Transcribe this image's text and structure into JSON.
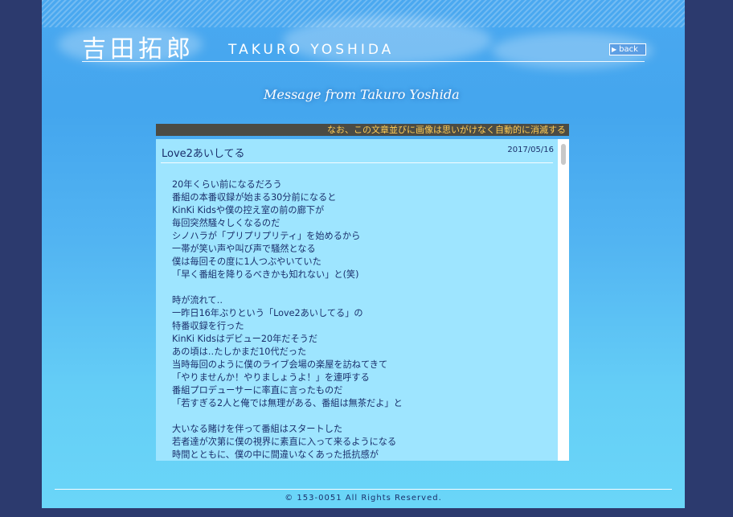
{
  "header": {
    "title_jp": "吉田拓郎",
    "title_en": "TAKURO YOSHIDA",
    "back_label": "back",
    "subtitle": "Message from Takuro Yoshida"
  },
  "notice": "なお、この文章並びに画像は思いがけなく自動的に消滅する",
  "post": {
    "title": "Love2あいしてる",
    "date": "2017/05/16",
    "lines": [
      "20年くらい前になるだろう",
      "番組の本番収録が始まる30分前になると",
      "KinKi Kidsや僕の控え室の前の廊下が",
      "毎回突然騒々しくなるのだ",
      "シノハラが「プリプリプリティ」を始めるから",
      "一帯が笑い声や叫び声で騒然となる",
      "僕は毎回その度に1人つぶやいていた",
      "「早く番組を降りるべきかも知れない」と(笑)",
      "",
      "時が流れて‥",
      "一昨日16年ぶりという「Love2あいしてる」の",
      "特番収録を行った",
      "KinKi Kidsはデビュー20年だそうだ",
      "あの頃は‥たしかまだ10代だった",
      "当時毎回のように僕のライブ会場の楽屋を訪ねてきて",
      "「やりませんか！やりましょうよ！」を連呼する",
      "番組プロデューサーに率直に言ったものだ",
      "「若すぎる2人と俺では無理がある、番組は無茶だよ」と",
      "",
      "大いなる賭けを伴って番組はスタートした",
      "若者達が次第に僕の視界に素直に入って来るようになる",
      "時間とともに、僕の中に間違いなくあった抵抗感が"
    ]
  },
  "footer": {
    "copyright": "© 153-0051 All Rights Reserved."
  }
}
